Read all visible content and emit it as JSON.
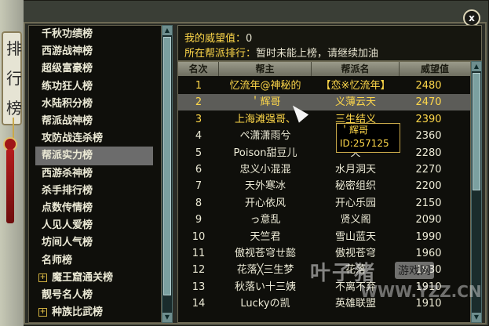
{
  "decor": {
    "text_top": "排",
    "text_mid": "行",
    "text_bot": "榜"
  },
  "window": {
    "close_label": "x"
  },
  "info": {
    "prestige_label": "我的威望值：",
    "prestige_value": "0",
    "guild_rank_label": "所在帮派排行：",
    "guild_rank_value": "暂时未能上榜，请继续加油"
  },
  "categories": [
    {
      "label": "千秋功绩榜",
      "expandable": false
    },
    {
      "label": "西游战神榜",
      "expandable": false
    },
    {
      "label": "超级富豪榜",
      "expandable": false
    },
    {
      "label": "练功狂人榜",
      "expandable": false
    },
    {
      "label": "水陆积分榜",
      "expandable": false
    },
    {
      "label": "帮派战神榜",
      "expandable": false
    },
    {
      "label": "攻防战连杀榜",
      "expandable": false
    },
    {
      "label": "帮派实力榜",
      "expandable": false,
      "selected": true
    },
    {
      "label": "西游杀神榜",
      "expandable": false
    },
    {
      "label": "杀手排行榜",
      "expandable": false
    },
    {
      "label": "点数传情榜",
      "expandable": false
    },
    {
      "label": "人见人爱榜",
      "expandable": false
    },
    {
      "label": "坊间人气榜",
      "expandable": false
    },
    {
      "label": "名师榜",
      "expandable": false
    },
    {
      "label": "魔王窟通关榜",
      "expandable": true
    },
    {
      "label": "靓号名人榜",
      "expandable": false
    },
    {
      "label": "种族比武榜",
      "expandable": true
    }
  ],
  "table": {
    "headers": [
      "名次",
      "帮主",
      "帮派名",
      "威望值"
    ],
    "rows": [
      {
        "rank": "1",
        "leader": "忆流年@神秘的",
        "guild": "【恋※忆流年】",
        "value": "2480",
        "color": "#ffd84a",
        "guild_color": "#ffd84a",
        "value_color": "#ffd84a"
      },
      {
        "rank": "2",
        "leader": "＇辉哥",
        "guild": "义薄云天",
        "value": "2470",
        "color": "#ffd84a",
        "guild_color": "#ffd84a",
        "value_color": "#ffd84a",
        "selected": true
      },
      {
        "rank": "3",
        "leader": "上海滩强哥、",
        "guild": "三生结义",
        "value": "2390",
        "color": "#ffd84a",
        "guild_color": "#ffd84a",
        "value_color": "#ffd84a"
      },
      {
        "rank": "4",
        "leader": "ペ潇潇雨兮",
        "guild": "战",
        "value": "2360",
        "color": "#ecead6",
        "guild_color": "#ecead6",
        "value_color": "#ecead6"
      },
      {
        "rank": "5",
        "leader": "Poison甜豆儿",
        "guild": "天",
        "value": "2280",
        "color": "#ecead6",
        "guild_color": "#ecead6",
        "value_color": "#ecead6"
      },
      {
        "rank": "6",
        "leader": "忠义小混混",
        "guild": "水月洞天",
        "value": "2270",
        "color": "#ecead6",
        "guild_color": "#ecead6",
        "value_color": "#ecead6"
      },
      {
        "rank": "7",
        "leader": "天外寒冰",
        "guild": "秘密组织",
        "value": "2200",
        "color": "#ecead6",
        "guild_color": "#ecead6",
        "value_color": "#ecead6"
      },
      {
        "rank": "8",
        "leader": "开心依风",
        "guild": "开心乐园",
        "value": "2150",
        "color": "#ecead6",
        "guild_color": "#ecead6",
        "value_color": "#ecead6"
      },
      {
        "rank": "9",
        "leader": "っ意乱",
        "guild": "贤义阁",
        "value": "2090",
        "color": "#ecead6",
        "guild_color": "#ecead6",
        "value_color": "#ecead6"
      },
      {
        "rank": "10",
        "leader": "天竺君",
        "guild": "雪山蓝天",
        "value": "1990",
        "color": "#ecead6",
        "guild_color": "#ecead6",
        "value_color": "#ecead6"
      },
      {
        "rank": "11",
        "leader": "傲视苍穹ㄝ懿",
        "guild": "傲视苍穹",
        "value": "1960",
        "color": "#ecead6",
        "guild_color": "#ecead6",
        "value_color": "#ecead6"
      },
      {
        "rank": "12",
        "leader": "花落╳三生梦",
        "guild": "花落",
        "value": "1930",
        "color": "#ecead6",
        "guild_color": "#ecead6",
        "value_color": "#ecead6"
      },
      {
        "rank": "13",
        "leader": "秋落い十三姨",
        "guild": "不离不弃",
        "value": "1910",
        "color": "#ecead6",
        "guild_color": "#ecead6",
        "value_color": "#ecead6"
      },
      {
        "rank": "14",
        "leader": "Luckyの凯",
        "guild": "英雄联盟",
        "value": "1910",
        "color": "#ecead6",
        "guild_color": "#ecead6",
        "value_color": "#ecead6"
      }
    ]
  },
  "tooltip": {
    "name": "＇辉哥",
    "id": "ID:257125"
  },
  "watermark": {
    "logo": "叶子猪",
    "tag": "游戏网",
    "url": "WWW.YZZ.CN"
  },
  "colors": {
    "accent": "#ffd84a",
    "text": "#ecead6",
    "selected_row": "#5c5c58"
  },
  "icons": {
    "cursor": "pointer-cursor-icon",
    "close": "close-icon",
    "expand": "plus-icon"
  }
}
